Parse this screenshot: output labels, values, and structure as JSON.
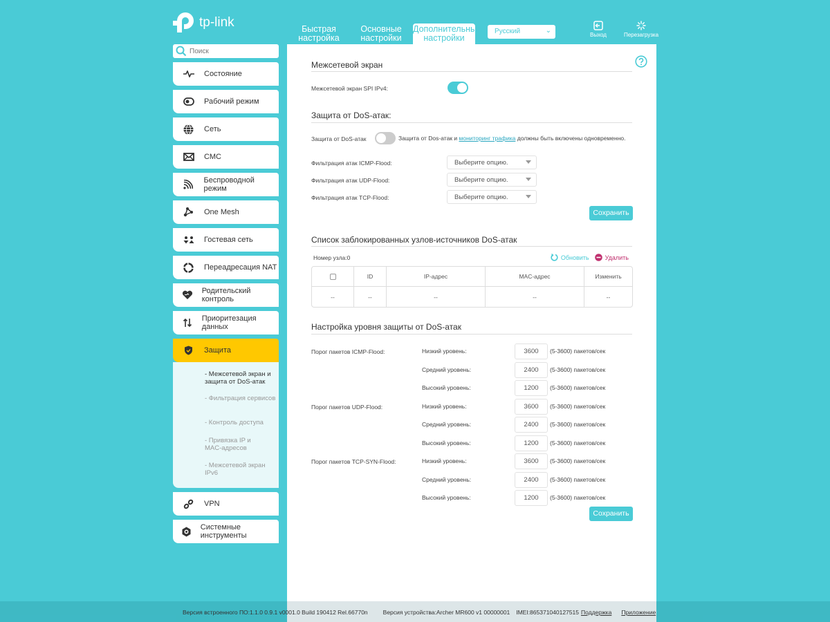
{
  "brand": {
    "logo_text": "tp-link"
  },
  "header": {
    "tabs": [
      {
        "label": "Быстрая настройка",
        "active": false
      },
      {
        "label": "Основные настройки",
        "active": false
      },
      {
        "label": "Дополнительные настройки",
        "active": true
      }
    ],
    "language": "Русский",
    "logout_label": "Выход",
    "reboot_label": "Перезагрузка"
  },
  "sidebar": {
    "search_placeholder": "Поиск",
    "items": [
      {
        "label": "Состояние",
        "icon": "pulse-icon"
      },
      {
        "label": "Рабочий режим",
        "icon": "toggle-mode-icon"
      },
      {
        "label": "Сеть",
        "icon": "globe-icon"
      },
      {
        "label": "СМС",
        "icon": "envelope-icon"
      },
      {
        "label": "Беспроводной режим",
        "icon": "wifi-icon"
      },
      {
        "label": "One Mesh",
        "icon": "mesh-icon"
      },
      {
        "label": "Гостевая сеть",
        "icon": "guests-icon"
      },
      {
        "label": "Переадресация NAT",
        "icon": "nat-icon"
      },
      {
        "label": "Родительский контроль",
        "icon": "heart-icon"
      },
      {
        "label": "Приоритезация данных",
        "icon": "priority-arrows-icon"
      },
      {
        "label": "Защита",
        "icon": "shield-icon",
        "active": true
      },
      {
        "label": "VPN",
        "icon": "link-icon"
      },
      {
        "label": "Системные инструменты",
        "icon": "gear-icon"
      }
    ],
    "submenu": [
      {
        "label": "- Межсетевой экран и защита от DoS-атак",
        "current": true
      },
      {
        "label": "- Фильтрация сервисов",
        "current": false
      },
      {
        "label": "- Контроль доступа",
        "current": false
      },
      {
        "label": "- Привязка IP и MAC-адресов",
        "current": false
      },
      {
        "label": "- Межсетевой экран IPv6",
        "current": false
      }
    ]
  },
  "firewall": {
    "title": "Межсетевой экран",
    "spi_label": "Межсетевой экран SPI IPv4:",
    "spi_enabled": true
  },
  "dos": {
    "title": "Защита от DoS-атак:",
    "label": "Защита от DoS-атак",
    "enabled": false,
    "note_before": "Защита от Dos-атак и ",
    "note_link": "мониторинг трафика",
    "note_after": " должны быть включены одновременно.",
    "filters": [
      {
        "label": "Фильтрация атак ICMP-Flood:",
        "value": "Выберите опцию."
      },
      {
        "label": "Фильтрация атак UDP-Flood:",
        "value": "Выберите опцию."
      },
      {
        "label": "Фильтрация атак TCP-Flood:",
        "value": "Выберите опцию."
      }
    ],
    "save_label": "Сохранить"
  },
  "blocked": {
    "title": "Список заблокированных узлов-источников DoS-атак",
    "count_label": "Номер узла:0",
    "refresh_label": "Обновить",
    "delete_label": "Удалить",
    "columns": [
      "",
      "ID",
      "IP-адрес",
      "MAC-адрес",
      "Изменить"
    ],
    "rows": [
      [
        "--",
        "--",
        "--",
        "--",
        "--"
      ]
    ]
  },
  "levels": {
    "title": "Настройка уровня защиты от DoS-атак",
    "groups": [
      {
        "label": "Порог пакетов ICMP-Flood:",
        "rows": [
          {
            "label": "Низкий уровень:",
            "value": "3600",
            "range": "(5-3600) пакетов/сек"
          },
          {
            "label": "Средний уровень:",
            "value": "2400",
            "range": "(5-3600) пакетов/сек"
          },
          {
            "label": "Высокий уровень:",
            "value": "1200",
            "range": "(5-3600) пакетов/сек"
          }
        ]
      },
      {
        "label": "Порог пакетов UDP-Flood:",
        "rows": [
          {
            "label": "Низкий уровень:",
            "value": "3600",
            "range": "(5-3600) пакетов/сек"
          },
          {
            "label": "Средний уровень:",
            "value": "2400",
            "range": "(5-3600) пакетов/сек"
          },
          {
            "label": "Высокий уровень:",
            "value": "1200",
            "range": "(5-3600) пакетов/сек"
          }
        ]
      },
      {
        "label": "Порог пакетов TCP-SYN-Flood:",
        "rows": [
          {
            "label": "Низкий уровень:",
            "value": "3600",
            "range": "(5-3600) пакетов/сек"
          },
          {
            "label": "Средний уровень:",
            "value": "2400",
            "range": "(5-3600) пакетов/сек"
          },
          {
            "label": "Высокий уровень:",
            "value": "1200",
            "range": "(5-3600) пакетов/сек"
          }
        ]
      }
    ],
    "save_label": "Сохранить"
  },
  "footer": {
    "firmware": "Версия встроенного ПО:1.1.0 0.9.1 v0001.0 Build 190412 Rel.66770n",
    "hardware": "Версия устройства:Archer MR600 v1 00000001",
    "imei": "IMEI:865371040127515",
    "support_link": "Поддержка",
    "app_link": "Приложение"
  },
  "colors": {
    "accent": "#4acbd6",
    "active_nav": "#ffc800",
    "delete": "#c0306e",
    "submenu_bg": "#e8f8f9"
  }
}
